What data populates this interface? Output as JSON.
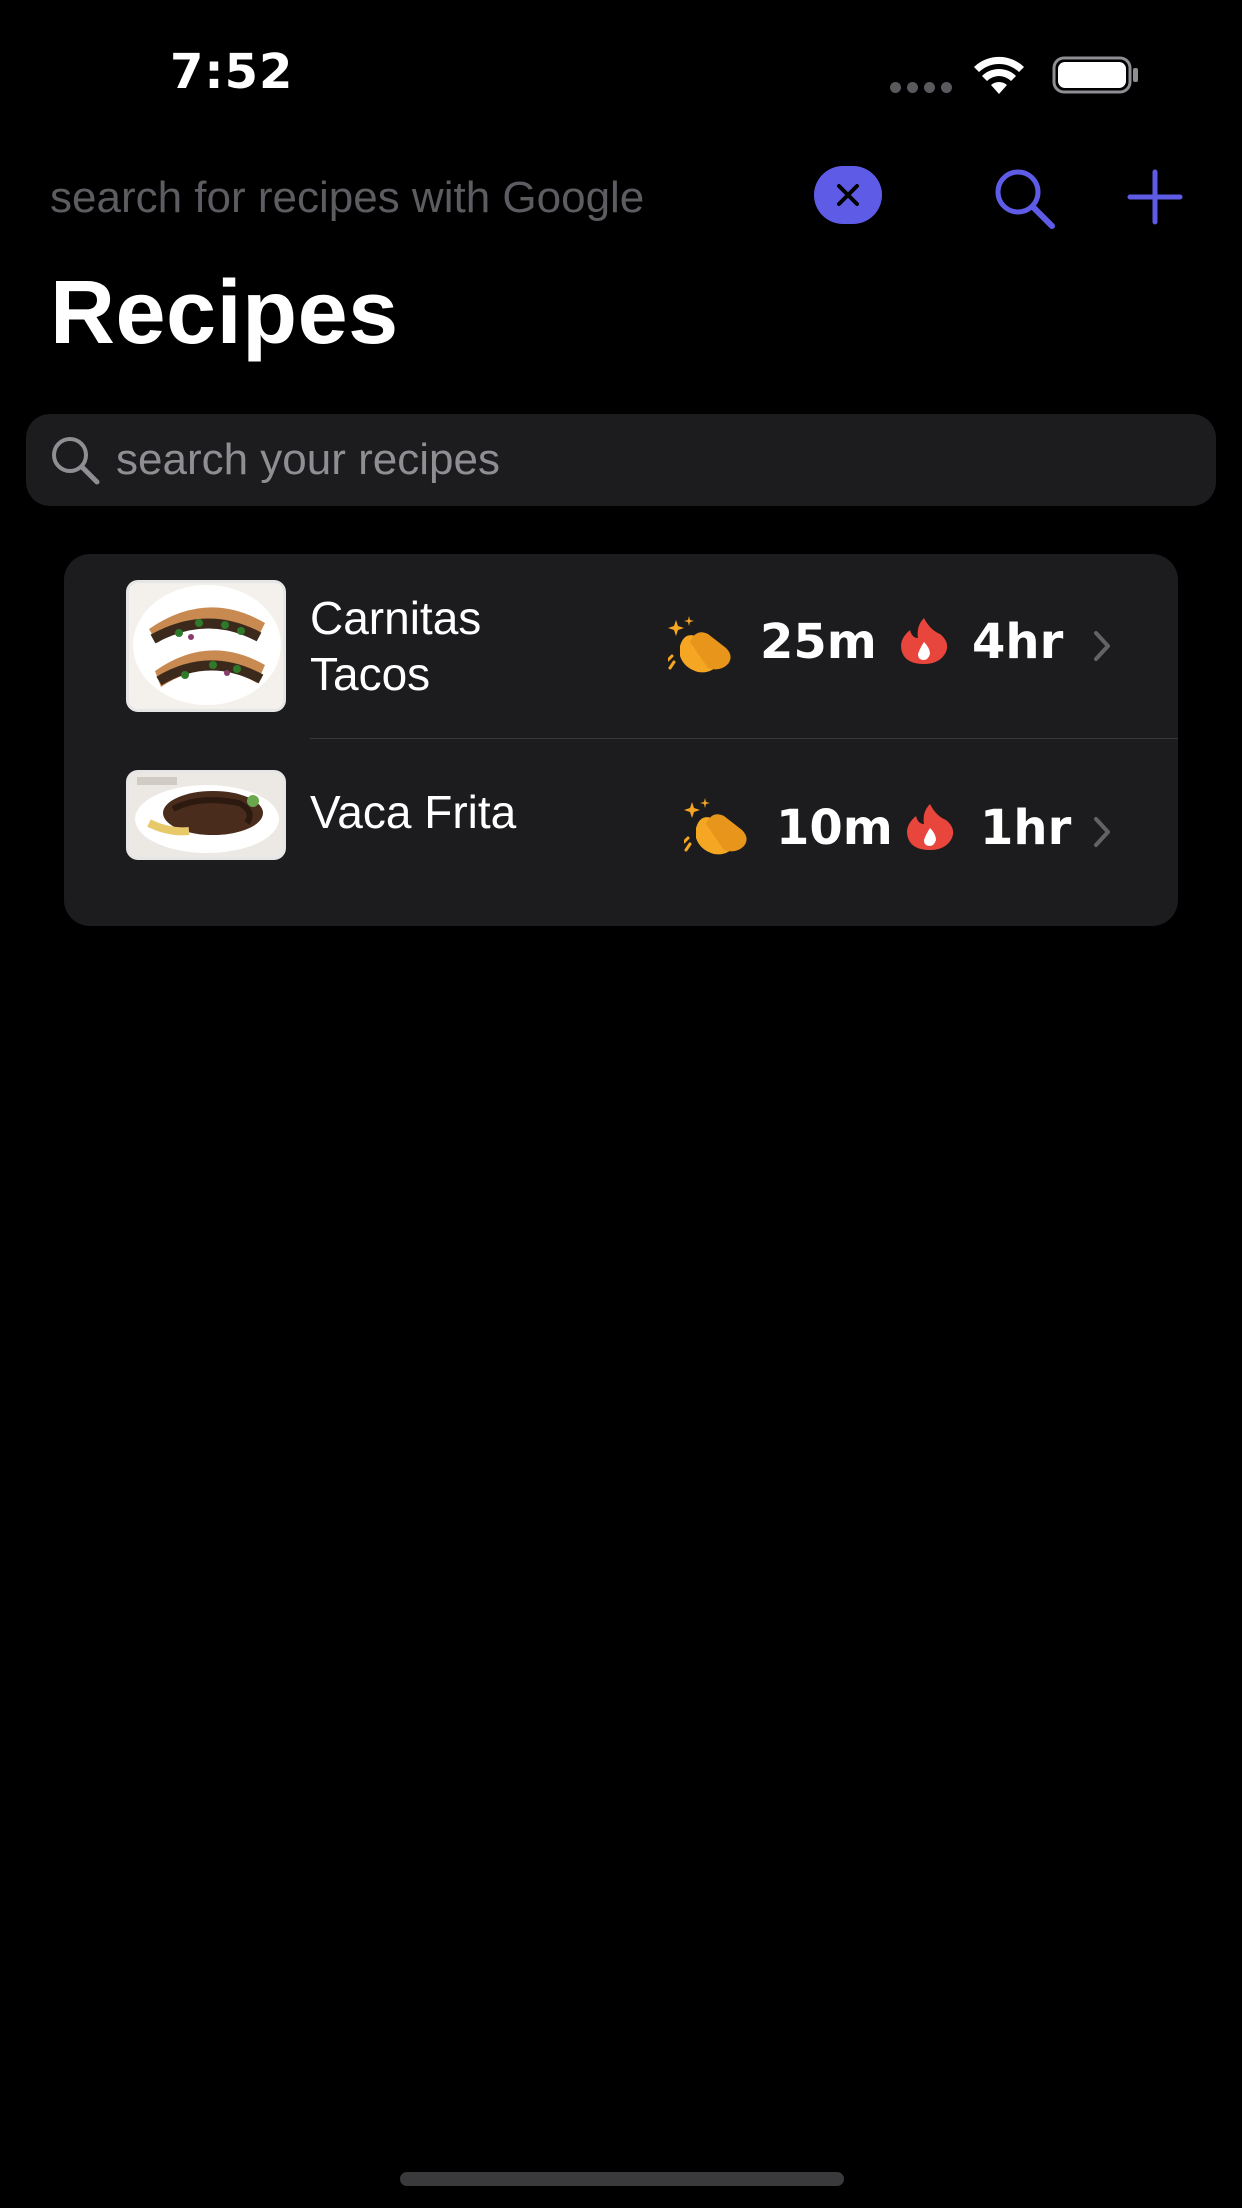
{
  "status_bar": {
    "time": "7:52"
  },
  "nav": {
    "google_search_placeholder": "search for recipes with Google",
    "title": "Recipes"
  },
  "search": {
    "placeholder": "search your recipes"
  },
  "recipes": [
    {
      "name": "Carnitas Tacos",
      "prep_time": "25m",
      "cook_time": "4hr"
    },
    {
      "name": "Vaca Frita",
      "prep_time": "10m",
      "cook_time": "1hr"
    }
  ],
  "colors": {
    "accent": "#5e5ce6",
    "background": "#000000",
    "card": "#1c1c1e",
    "clap_icon": "#f5a623",
    "fire_icon": "#e8453c"
  },
  "icons": {
    "clear": "xmark-circle-icon",
    "search": "magnifying-glass-icon",
    "add": "plus-icon",
    "prep": "clapping-hands-icon",
    "cook": "fire-icon",
    "disclosure": "chevron-right-icon"
  }
}
